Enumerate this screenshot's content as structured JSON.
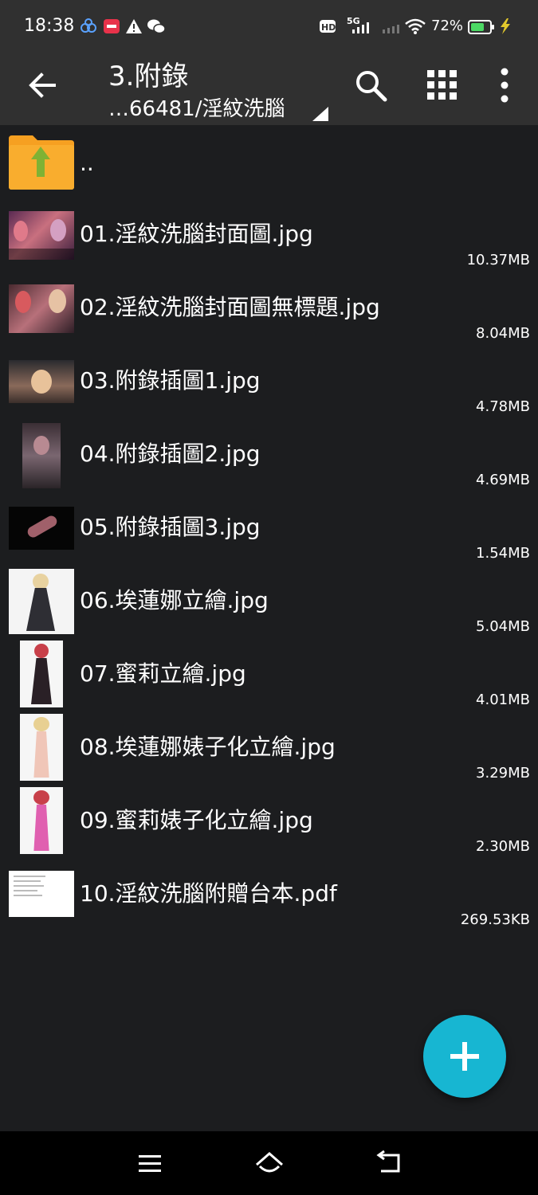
{
  "status_bar": {
    "time": "18:38",
    "network_label": "5G",
    "hd_label": "HD",
    "battery": "72%",
    "battery_level": 0.72,
    "battery_color": "#4cd964"
  },
  "toolbar": {
    "title": "3.附錄",
    "path": "…66481/淫紋洗腦",
    "icons": [
      "back-arrow-icon",
      "search-icon",
      "grid-view-icon",
      "more-vert-icon"
    ]
  },
  "parent_entry": {
    "label": ".."
  },
  "files": [
    {
      "name": "01.淫紋洗腦封面圖.jpg",
      "size": "10.37MB"
    },
    {
      "name": "02.淫紋洗腦封面圖無標題.jpg",
      "size": "8.04MB"
    },
    {
      "name": "03.附錄插圖1.jpg",
      "size": "4.78MB"
    },
    {
      "name": "04.附錄插圖2.jpg",
      "size": "4.69MB"
    },
    {
      "name": "05.附錄插圖3.jpg",
      "size": "1.54MB"
    },
    {
      "name": "06.埃蓮娜立繪.jpg",
      "size": "5.04MB"
    },
    {
      "name": "07.蜜莉立繪.jpg",
      "size": "4.01MB"
    },
    {
      "name": "08.埃蓮娜婊子化立繪.jpg",
      "size": "3.29MB"
    },
    {
      "name": "09.蜜莉婊子化立繪.jpg",
      "size": "2.30MB"
    },
    {
      "name": "10.淫紋洗腦附贈台本.pdf",
      "size": "269.53KB"
    }
  ],
  "fab": {
    "icon": "plus-icon",
    "color": "#17b6d2"
  },
  "nav": {
    "icons": [
      "menu-icon",
      "home-icon",
      "back-icon"
    ]
  }
}
